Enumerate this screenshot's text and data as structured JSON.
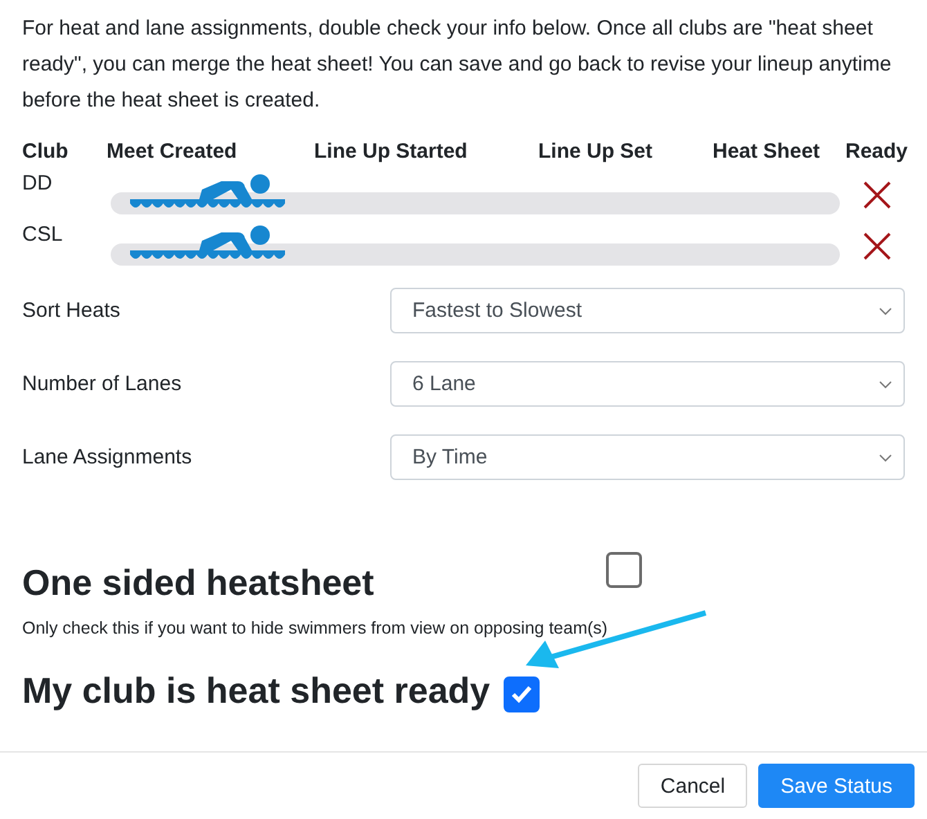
{
  "intro": "For heat and lane assignments, double check your info below. Once all clubs are \"heat sheet ready\", you can merge the heat sheet! You can save and go back to revise your lineup anytime before the heat sheet is created.",
  "columns": [
    "Club",
    "Meet Created",
    "Line Up Started",
    "Line Up Set",
    "Heat Sheet",
    "Ready"
  ],
  "clubs": [
    {
      "name": "DD",
      "level": 0.24,
      "ready": false
    },
    {
      "name": "CSL",
      "level": 0.24,
      "ready": false
    }
  ],
  "settings": [
    {
      "label": "Sort Heats",
      "value": "Fastest to Slowest"
    },
    {
      "label": "Number of Lanes",
      "value": "6 Lane"
    },
    {
      "label": "Lane Assignments",
      "value": "By Time"
    }
  ],
  "one_sided": {
    "title": "One sided heatsheet",
    "checked": false,
    "note": "Only check this if you want to hide swimmers from view on opposing team(s)"
  },
  "ready_option": {
    "title": "My club is heat sheet ready",
    "checked": true
  },
  "buttons": [
    {
      "label": "Cancel",
      "kind": "secondary"
    },
    {
      "label": "Save Status",
      "kind": "primary"
    }
  ]
}
